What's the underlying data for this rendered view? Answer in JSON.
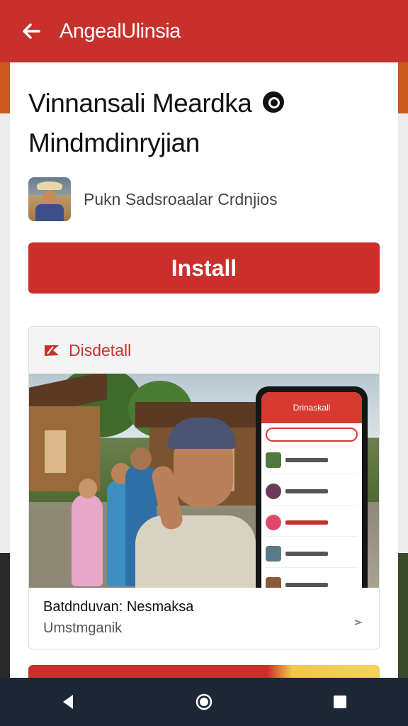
{
  "appbar": {
    "title": "AngealUlinsia",
    "back_icon": "arrow-left-icon"
  },
  "app": {
    "title_line1": "Vinnansali Meardka",
    "title_line2": "Mindmdinryjian",
    "badge_icon": "registered-badge-icon",
    "developer": "Pukn Sadsroaalar Crdnjios",
    "install_label": "Install"
  },
  "feature": {
    "header_label": "Disdetall",
    "phone_app_title": "Drinaskall",
    "caption": "Batdnduvan: Nesmaksa",
    "subcaption": "Umstmganik"
  },
  "colors": {
    "brand_red": "#c8312b",
    "nav_bar": "#1d2736"
  },
  "system_nav": {
    "back_icon": "triangle-back-icon",
    "home_icon": "circle-home-icon",
    "recents_icon": "square-recents-icon"
  }
}
